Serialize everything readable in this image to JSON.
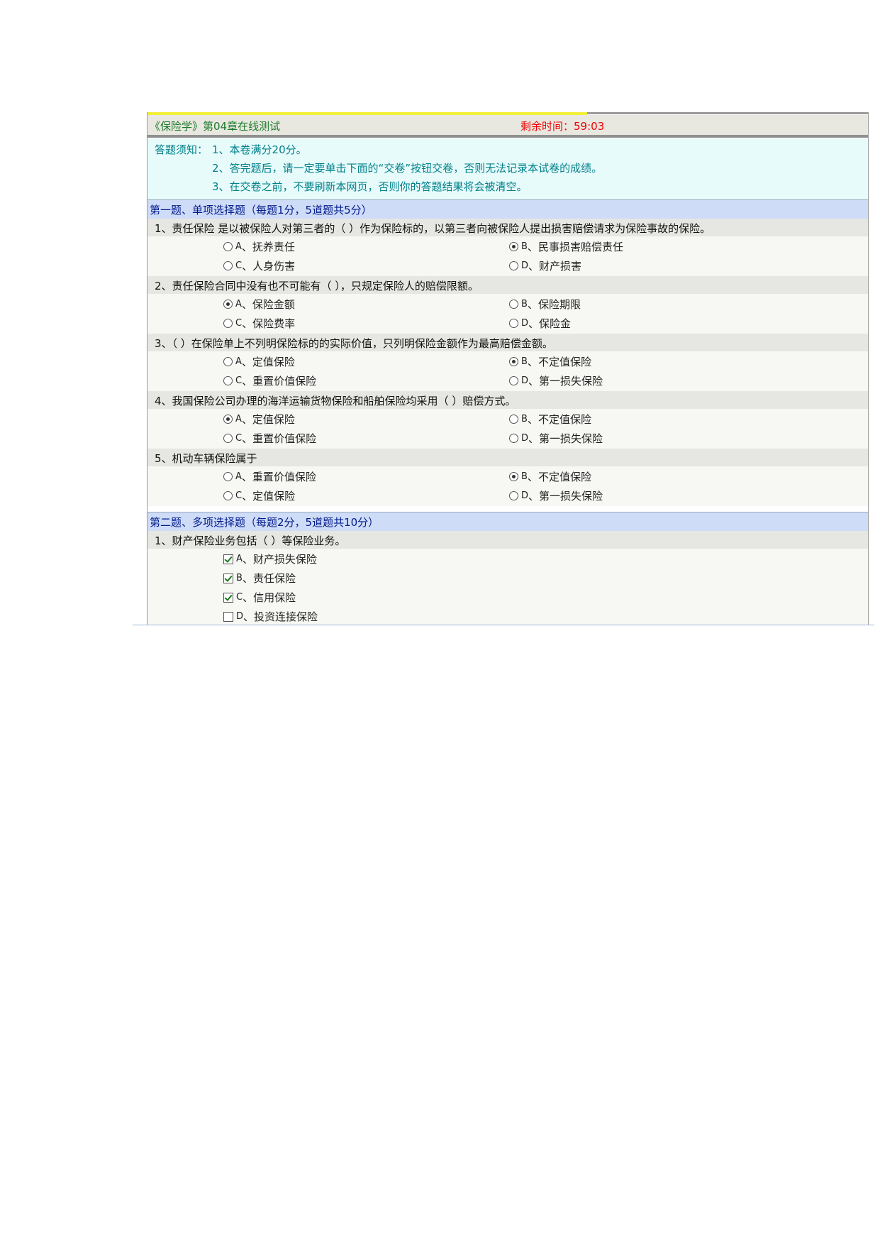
{
  "header": {
    "title": "《保险学》第04章在线测试",
    "timer_label": "剩余时间：",
    "timer_value": "59:03"
  },
  "notice": {
    "label": "答题须知：",
    "lines": [
      "1、本卷满分20分。",
      "2、答完题后，请一定要单击下面的“交卷”按钮交卷，否则无法记录本试卷的成绩。",
      "3、在交卷之前，不要刷新本网页，否则你的答题结果将会被清空。"
    ]
  },
  "section1": {
    "title": "第一题、单项选择题（每题1分，5道题共5分）",
    "questions": [
      {
        "text": "1、责任保险 是以被保险人对第三者的（ ）作为保险标的，以第三者向被保险人提出损害赔偿请求为保险事故的保险。",
        "options": [
          {
            "letter": "A",
            "sep": "、",
            "text": "抚养责任",
            "selected": false
          },
          {
            "letter": "B",
            "sep": "、",
            "text": "民事损害赔偿责任",
            "selected": true
          },
          {
            "letter": "C",
            "sep": "、",
            "text": "人身伤害",
            "selected": false
          },
          {
            "letter": "D",
            "sep": "、",
            "text": "财产损害",
            "selected": false
          }
        ]
      },
      {
        "text": "2、责任保险合同中没有也不可能有（ ），只规定保险人的赔偿限额。",
        "options": [
          {
            "letter": "A",
            "sep": "、",
            "text": "保险金额",
            "selected": true
          },
          {
            "letter": "B",
            "sep": "、",
            "text": "保险期限",
            "selected": false
          },
          {
            "letter": "C",
            "sep": "、",
            "text": "保险费率",
            "selected": false
          },
          {
            "letter": "D",
            "sep": "、",
            "text": "保险金",
            "selected": false
          }
        ]
      },
      {
        "text": "3、（ ）在保险单上不列明保险标的的实际价值，只列明保险金额作为最高赔偿金额。",
        "options": [
          {
            "letter": "A",
            "sep": "、",
            "text": "定值保险",
            "selected": false
          },
          {
            "letter": "B",
            "sep": "、",
            "text": "不定值保险",
            "selected": true
          },
          {
            "letter": "C",
            "sep": "、",
            "text": "重置价值保险",
            "selected": false
          },
          {
            "letter": "D",
            "sep": "、",
            "text": "第一损失保险",
            "selected": false
          }
        ]
      },
      {
        "text": "4、我国保险公司办理的海洋运输货物保险和船舶保险均采用（ ）赔偿方式。",
        "options": [
          {
            "letter": "A",
            "sep": "、",
            "text": "定值保险",
            "selected": true
          },
          {
            "letter": "B",
            "sep": "、",
            "text": "不定值保险",
            "selected": false
          },
          {
            "letter": "C",
            "sep": "、",
            "text": "重置价值保险",
            "selected": false
          },
          {
            "letter": "D",
            "sep": "、",
            "text": "第一损失保险",
            "selected": false
          }
        ]
      },
      {
        "text": "5、机动车辆保险属于",
        "options": [
          {
            "letter": "A",
            "sep": "、",
            "text": "重置价值保险",
            "selected": false
          },
          {
            "letter": "B",
            "sep": "、",
            "text": "不定值保险",
            "selected": true
          },
          {
            "letter": "C",
            "sep": "、",
            "text": "定值保险",
            "selected": false
          },
          {
            "letter": "D",
            "sep": "、",
            "text": "第一损失保险",
            "selected": false
          }
        ]
      }
    ]
  },
  "section2": {
    "title": "第二题、多项选择题（每题2分，5道题共10分）",
    "questions": [
      {
        "text": "1、财产保险业务包括（ ）等保险业务。",
        "options": [
          {
            "letter": "A",
            "sep": "、",
            "text": "财产损失保险",
            "checked": true
          },
          {
            "letter": "B",
            "sep": "、",
            "text": "责任保险",
            "checked": true
          },
          {
            "letter": "C",
            "sep": "、",
            "text": "信用保险",
            "checked": true
          },
          {
            "letter": "D",
            "sep": "、",
            "text": "投资连接保险",
            "checked": false
          }
        ]
      }
    ]
  }
}
